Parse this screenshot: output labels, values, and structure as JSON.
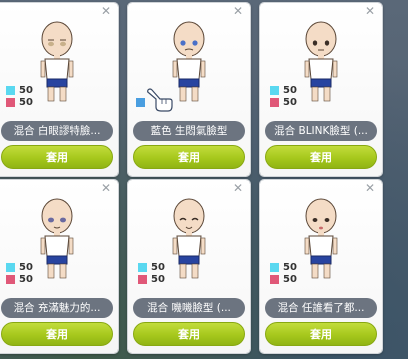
{
  "stat_colors": {
    "stat1": "#5ad8f0",
    "stat2": "#e05878"
  },
  "apply_color": "#a6c81c",
  "cards": [
    {
      "name": "混合 白眼謬特臉...",
      "stat1": "50",
      "stat2": "50",
      "button": "套用",
      "close_icon": "close-icon"
    },
    {
      "name": "藍色 生悶氣臉型",
      "stat1": "",
      "stat2": "",
      "button": "套用",
      "close_icon": "close-icon",
      "cursor_icon": "pointing-hand-icon"
    },
    {
      "name": "混合 BLINK臉型 (...",
      "stat1": "50",
      "stat2": "50",
      "button": "套用",
      "close_icon": "close-icon"
    },
    {
      "name": "混合 充滿魅力的...",
      "stat1": "50",
      "stat2": "50",
      "button": "套用",
      "close_icon": "close-icon"
    },
    {
      "name": "混合 嘰嘰臉型 (...",
      "stat1": "50",
      "stat2": "50",
      "button": "套用",
      "close_icon": "close-icon"
    },
    {
      "name": "混合 任誰看了都...",
      "stat1": "50",
      "stat2": "50",
      "button": "套用",
      "close_icon": "close-icon"
    }
  ]
}
